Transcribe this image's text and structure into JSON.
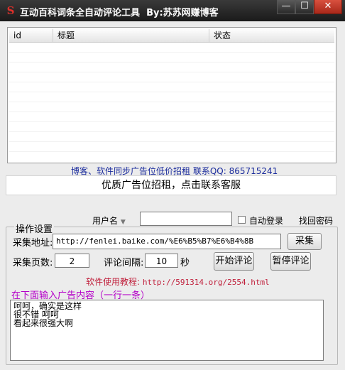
{
  "window": {
    "icon": "app-logo-icon",
    "title": "互动百科词条全自动评论工具",
    "author": "By:苏苏网赚博客",
    "controls": {
      "minimize": "—",
      "maximize": "☐",
      "close": "✕"
    }
  },
  "list": {
    "columns": [
      "id",
      "标题",
      "状态"
    ]
  },
  "promo": {
    "line": "博客、软件同步广告位低价招租  联系QQ: 865715241",
    "banner": "优质广告位招租，点击联系客服"
  },
  "login": {
    "username_label": "用户名",
    "dropdown_icon": "chevron-down-icon",
    "auto_login_label": "自动登录",
    "retrieve_password": "找回密码"
  },
  "settings": {
    "group_title": "操作设置",
    "url_label": "采集地址:",
    "url_value": "http://fenlei.baike.com/%E6%B5%B7%E6%B4%8B",
    "collect_button": "采集",
    "pages_label": "采集页数:",
    "pages_value": "2",
    "interval_label": "评论间隔:",
    "interval_value": "10",
    "seconds_unit": "秒",
    "start_button": "开始评论",
    "pause_button": "暂停评论"
  },
  "tutorial": {
    "label": "软件使用教程:",
    "url": "http://591314.org/2554.html"
  },
  "ads": {
    "label": "在下面输入广告内容（一行一条）",
    "lines": [
      "呵呵，确实是这样",
      "很不错 呵呵",
      "看起来很强大啊"
    ]
  },
  "colors": {
    "titlebar": "#2a2a2a",
    "promo_text": "#1a2b9c",
    "tutorial_text": "#c0203c",
    "ad_label": "#b400c8"
  }
}
